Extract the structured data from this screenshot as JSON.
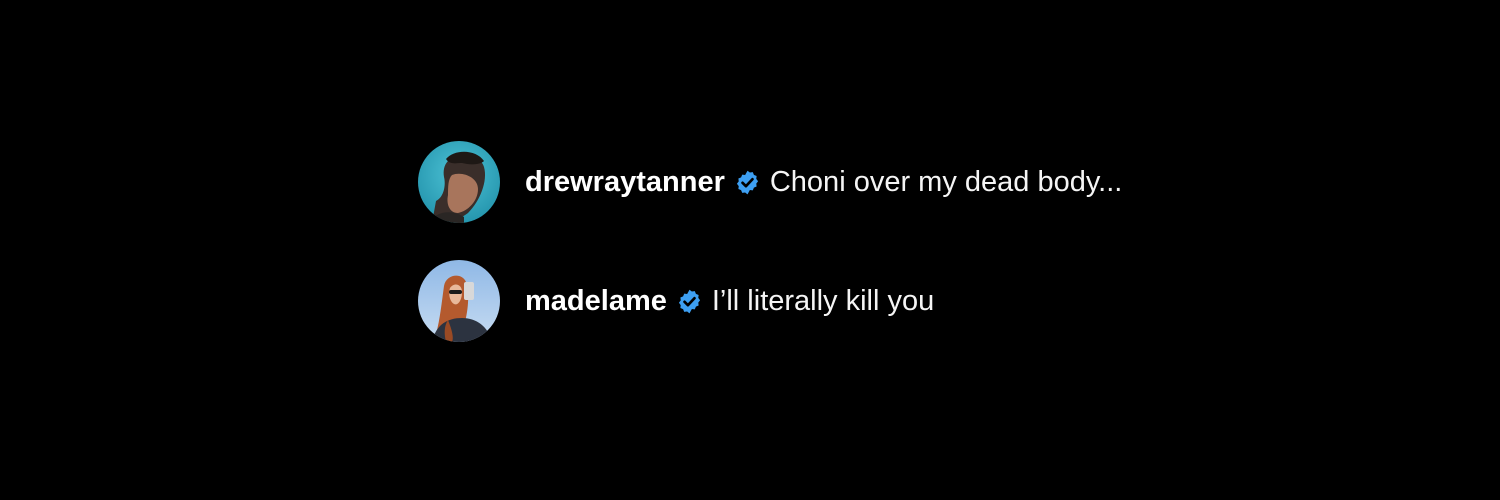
{
  "comments": [
    {
      "username": "drewraytanner",
      "verified_icon": "verified-badge-icon",
      "text": "Choni over my dead body..."
    },
    {
      "username": "madelame",
      "verified_icon": "verified-badge-icon",
      "text": "I’ll literally kill you"
    }
  ],
  "colors": {
    "background": "#000000",
    "username": "#ffffff",
    "text": "#f5f5f5",
    "verified": "#3d9ff2"
  }
}
